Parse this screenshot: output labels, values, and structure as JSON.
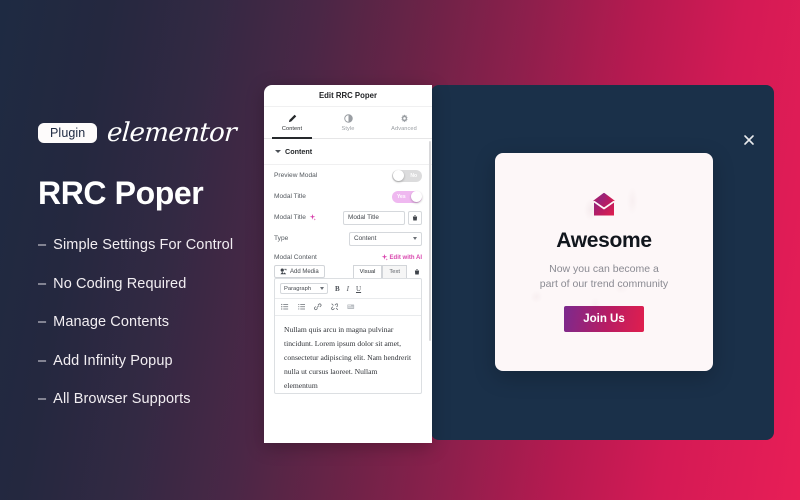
{
  "theme": {
    "bg_left": "#1e2a42",
    "bg_right": "#e81e56",
    "panel_dark": "#1a3049",
    "accent_pink": "#d946ae",
    "button_gradient_start": "#7b2a8e",
    "button_gradient_end": "#e01f4e"
  },
  "left": {
    "badge": "Plugin",
    "logo": "elementor",
    "title": "RRC Poper",
    "features": [
      {
        "dash": "–",
        "text": "Simple Settings For Control"
      },
      {
        "dash": "–",
        "text": "No Coding Required"
      },
      {
        "dash": "–",
        "text": "Manage Contents"
      },
      {
        "dash": "–",
        "text": "Add Infinity Popup"
      },
      {
        "dash": "–",
        "text": "All Browser Supports"
      }
    ]
  },
  "editor_panel": {
    "header_title": "Edit RRC Poper",
    "tabs": [
      {
        "label": "Content",
        "icon": "pencil-icon",
        "active": true
      },
      {
        "label": "Style",
        "icon": "contrast-icon",
        "active": false
      },
      {
        "label": "Advanced",
        "icon": "gear-icon",
        "active": false
      }
    ],
    "section_title": "Content",
    "rows": {
      "preview_modal": {
        "label": "Preview Modal",
        "toggle_value": "No",
        "toggle_on": false
      },
      "modal_title_toggle": {
        "label": "Modal Title",
        "toggle_value": "Yes",
        "toggle_on": true
      },
      "modal_title_field": {
        "label": "Modal Title",
        "value": "Modal Title",
        "ai_icon": "ai-sparkle-icon",
        "delete_icon": "trash-icon"
      },
      "type": {
        "label": "Type",
        "value": "Content"
      }
    },
    "modal_content": {
      "label": "Modal Content",
      "ai_link": "Edit with AI",
      "add_media": "Add Media",
      "view_tabs": [
        {
          "label": "Visual",
          "active": true
        },
        {
          "label": "Text",
          "active": false
        }
      ],
      "format_select": "Paragraph",
      "format_buttons": [
        {
          "label": "B",
          "name": "bold-button"
        },
        {
          "label": "I",
          "name": "italic-button"
        },
        {
          "label": "U",
          "name": "underline-button"
        }
      ],
      "tool_icons": [
        "bulleted-list-icon",
        "numbered-list-icon",
        "link-icon",
        "unlink-icon",
        "read-more-icon"
      ],
      "body_text": "Nullam quis arcu in magna pulvinar tincidunt. Lorem ipsum dolor sit amet, consectetur adipiscing elit. Nam hendrerit nulla ut cursus laoreet. Nullam elementum"
    }
  },
  "preview": {
    "close_icon": "close-icon",
    "modal": {
      "icon": "envelope-icon",
      "heading": "Awesome",
      "subtitle_line1": "Now you can become a",
      "subtitle_line2": "part of our trend community",
      "button_label": "Join Us"
    }
  }
}
